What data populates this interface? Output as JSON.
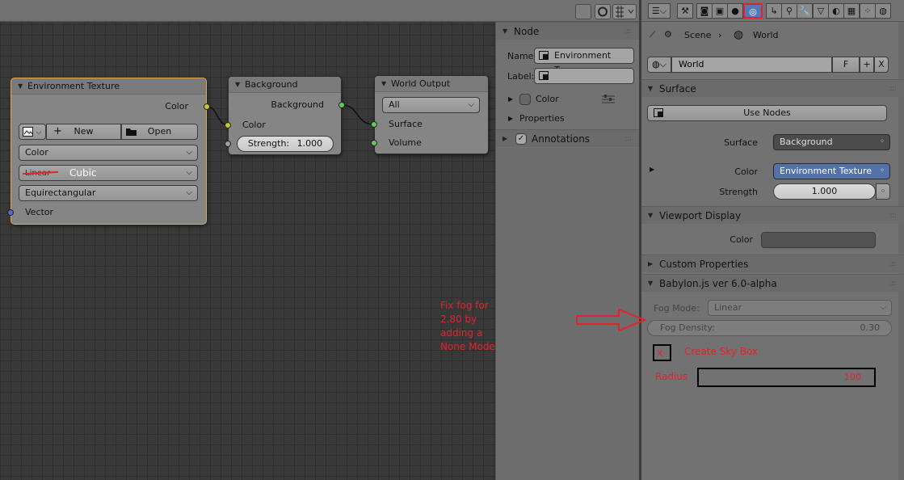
{
  "node_editor": {
    "nodes": {
      "env": {
        "title": "Environment Texture",
        "out_color": "Color",
        "new": "New",
        "open": "Open",
        "color_mode": "Color",
        "interp_crossed": "Linear",
        "interp_new": "Cubic",
        "projection": "Equirectangular",
        "in_vector": "Vector"
      },
      "bg": {
        "title": "Background",
        "out_background": "Background",
        "in_color": "Color",
        "strength_label": "Strength:",
        "strength_value": "1.000"
      },
      "wo": {
        "title": "World Output",
        "target": "All",
        "in_surface": "Surface",
        "in_volume": "Volume"
      }
    }
  },
  "n_panel": {
    "node_title": "Node",
    "name_label": "Name:",
    "name_value": "Environment Tex...",
    "label_label": "Label:",
    "color_label": "Color",
    "properties_label": "Properties",
    "annotations_label": "Annotations"
  },
  "props": {
    "breadcrumb_scene": "Scene",
    "breadcrumb_world": "World",
    "world_name": "World",
    "fake_user": "F",
    "add": "+",
    "close": "X",
    "surface_panel": "Surface",
    "use_nodes": "Use Nodes",
    "surface_label": "Surface",
    "surface_value": "Background",
    "color_label": "Color",
    "color_value": "Environment Texture",
    "strength_label": "Strength",
    "strength_value": "1.000",
    "viewport_panel": "Viewport Display",
    "viewport_color_label": "Color",
    "custom_props_panel": "Custom Properties",
    "babylon_panel": "Babylon.js ver 6.0-alpha",
    "fog_mode_label": "Fog Mode:",
    "fog_mode_value": "Linear",
    "fog_density_label": "Fog Density:",
    "fog_density_value": "0.30",
    "skybox_check": "X",
    "skybox_label": "Create Sky Box",
    "radius_label": "Radius",
    "radius_value": "100"
  },
  "annotation": {
    "line1": "Fix fog for 2.80 by",
    "line2": "adding a None Mode"
  },
  "colors": {
    "annotation_red": "#e3222a",
    "active_tab_outline": "#e3222a",
    "socket_color": "#c7c729",
    "socket_shader": "#63c763",
    "socket_float": "#a1a1a1",
    "socket_vector": "#6363c7"
  }
}
